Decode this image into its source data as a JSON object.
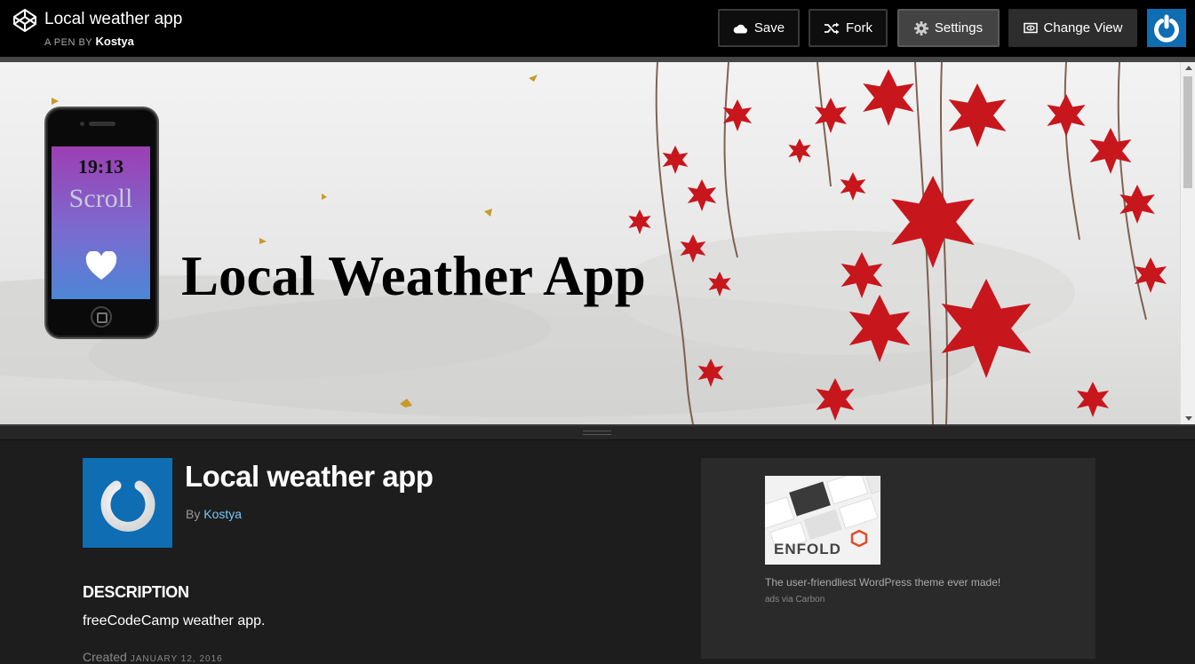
{
  "header": {
    "title": "Local weather app",
    "pen_by_label": "A PEN BY",
    "author": "Kostya",
    "buttons": {
      "save": "Save",
      "fork": "Fork",
      "settings": "Settings",
      "change_view": "Change View"
    }
  },
  "preview": {
    "phone_time": "19:13",
    "phone_scroll": "Scroll",
    "heading": "Local Weather App"
  },
  "details": {
    "title": "Local weather app",
    "by_label": "By",
    "author": "Kostya",
    "description_heading": "DESCRIPTION",
    "description": "freeCodeCamp weather app.",
    "created_label": "Created",
    "created_date": "JANUARY 12, 2016"
  },
  "ad": {
    "brand": "ENFOLD",
    "text": "The user-friendliest WordPress theme ever made!",
    "via": "ads via Carbon"
  },
  "colors": {
    "accent_blue": "#0e6db3",
    "link_blue": "#76c7f7",
    "leaf_red": "#c8161d"
  },
  "icons": [
    "codepen-logo-icon",
    "cloud-icon",
    "fork-icon",
    "gear-icon",
    "eye-icon",
    "power-icon",
    "heart-icon"
  ]
}
